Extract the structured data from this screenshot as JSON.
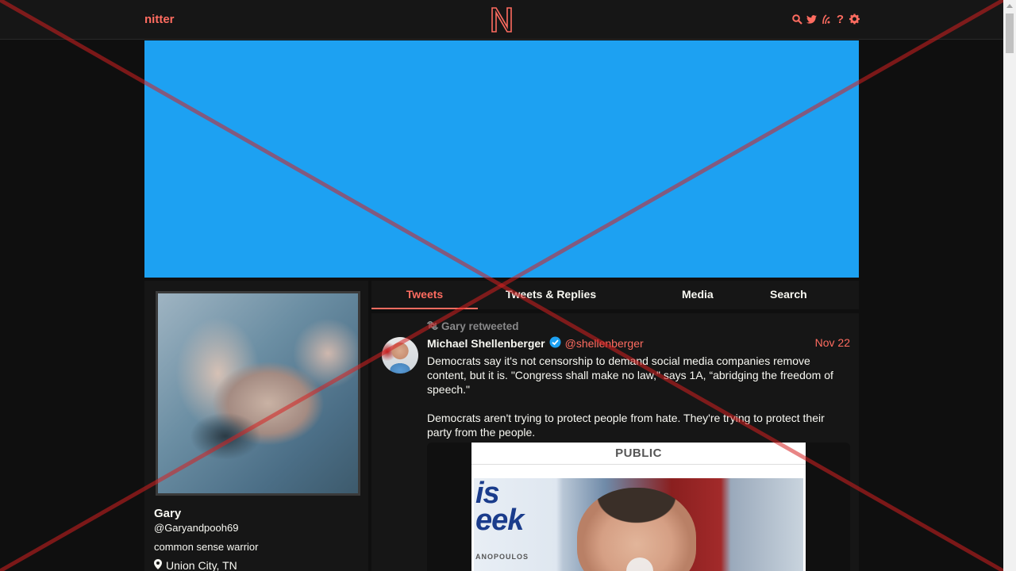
{
  "nav": {
    "brand": "nitter",
    "logo": "nitter-logo",
    "icons": [
      "search-icon",
      "twitter-icon",
      "rss-icon",
      "help-icon",
      "gear-icon"
    ],
    "accent": "#ff6c60"
  },
  "banner": {
    "color": "#1da1f2"
  },
  "profile": {
    "name": "Gary",
    "handle": "@Garyandpooh69",
    "bio": "common sense warrior",
    "location": "Union City, TN"
  },
  "tabs": [
    {
      "label": "Tweets",
      "active": true
    },
    {
      "label": "Tweets & Replies",
      "active": false
    },
    {
      "label": "Media",
      "active": false
    },
    {
      "label": "Search",
      "active": false
    }
  ],
  "tweet": {
    "retweet_label": "Gary retweeted",
    "fullname": "Michael Shellenberger",
    "username": "@shellenberger",
    "date": "Nov 22",
    "body": [
      "Democrats say it's not censorship to demand social media companies remove content, but it is. \"Congress shall make no law,\" says 1A, “abridging the freedom of speech.\"",
      "Democrats aren't trying to protect people from hate. They're trying to protect their party from the people."
    ],
    "media": {
      "card_label": "PUBLIC",
      "banner_text": "is\neek",
      "sub_text": "ANOPOULOS"
    }
  }
}
